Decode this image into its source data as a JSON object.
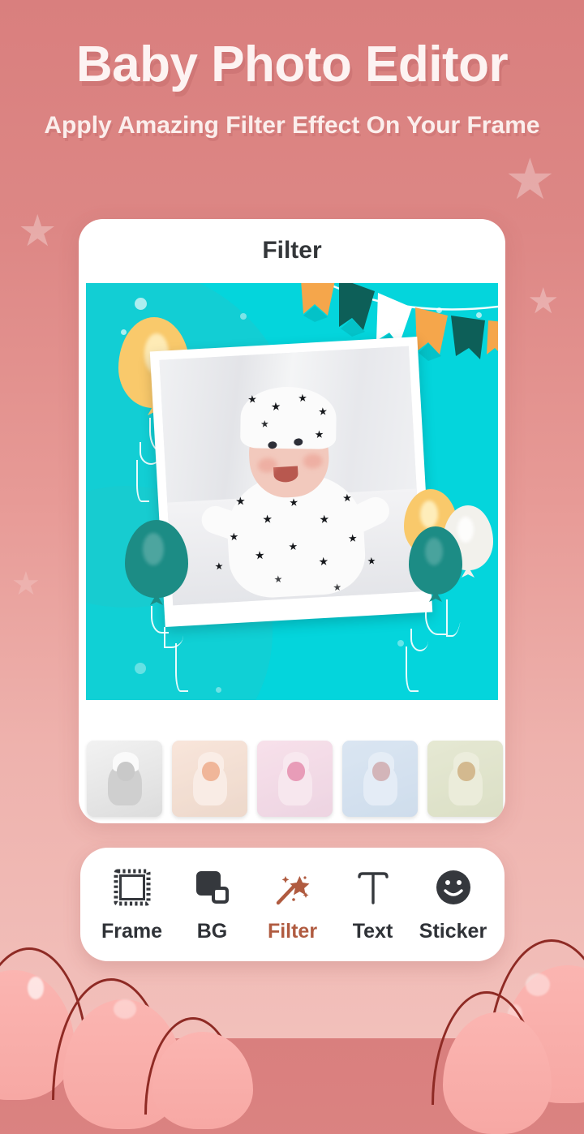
{
  "header": {
    "title": "Baby Photo Editor",
    "subtitle": "Apply Amazing Filter Effect On Your Frame"
  },
  "card": {
    "title": "Filter"
  },
  "canvas": {
    "background_color": "#04d5dc",
    "frame_color": "#ffffff",
    "subject_alt": "Smiling baby wearing a white star-print beanie and outfit lying on white bedding",
    "decorations": [
      {
        "name": "balloon-yellow-large",
        "color": "#f9c96b"
      },
      {
        "name": "balloon-teal-left",
        "color": "#1c8c85"
      },
      {
        "name": "balloon-yellow-right",
        "color": "#f9c96b"
      },
      {
        "name": "balloon-white-right",
        "color": "#f2f1ec"
      },
      {
        "name": "balloon-teal-right",
        "color": "#1c8c85"
      },
      {
        "name": "bunting-flag-orange",
        "color": "#f5a64b"
      },
      {
        "name": "bunting-flag-teal",
        "color": "#0d5f58"
      },
      {
        "name": "bunting-flag-white",
        "color": "#ffffff"
      }
    ]
  },
  "filters": {
    "count": 5,
    "items": [
      {
        "name": "grayscale",
        "label": "Grayscale",
        "tint": "#9a9a9a",
        "selected": false
      },
      {
        "name": "warm",
        "label": "Warm",
        "tint": "#f0b494",
        "selected": false
      },
      {
        "name": "pink",
        "label": "Pink",
        "tint": "#e9a7c3",
        "selected": false
      },
      {
        "name": "cool",
        "label": "Cool",
        "tint": "#a9c3e0",
        "selected": false
      },
      {
        "name": "vintage",
        "label": "Vintage",
        "tint": "#c8cba0",
        "selected": false
      }
    ]
  },
  "toolbar": {
    "active": "Filter",
    "active_color": "#b05b40",
    "items": [
      {
        "label": "Frame",
        "icon": "frame-stamp-icon"
      },
      {
        "label": "BG",
        "icon": "layers-squares-icon"
      },
      {
        "label": "Filter",
        "icon": "magic-wand-icon"
      },
      {
        "label": "Text",
        "icon": "text-t-icon"
      },
      {
        "label": "Sticker",
        "icon": "smiley-face-icon"
      }
    ]
  },
  "theme": {
    "bg_top": "#d97f7e",
    "bg_bottom": "#f2c0bb",
    "star_color": "#f3c5c2",
    "blob_outline": "#8e2a24",
    "blob_fill": "#f9aaa6"
  }
}
